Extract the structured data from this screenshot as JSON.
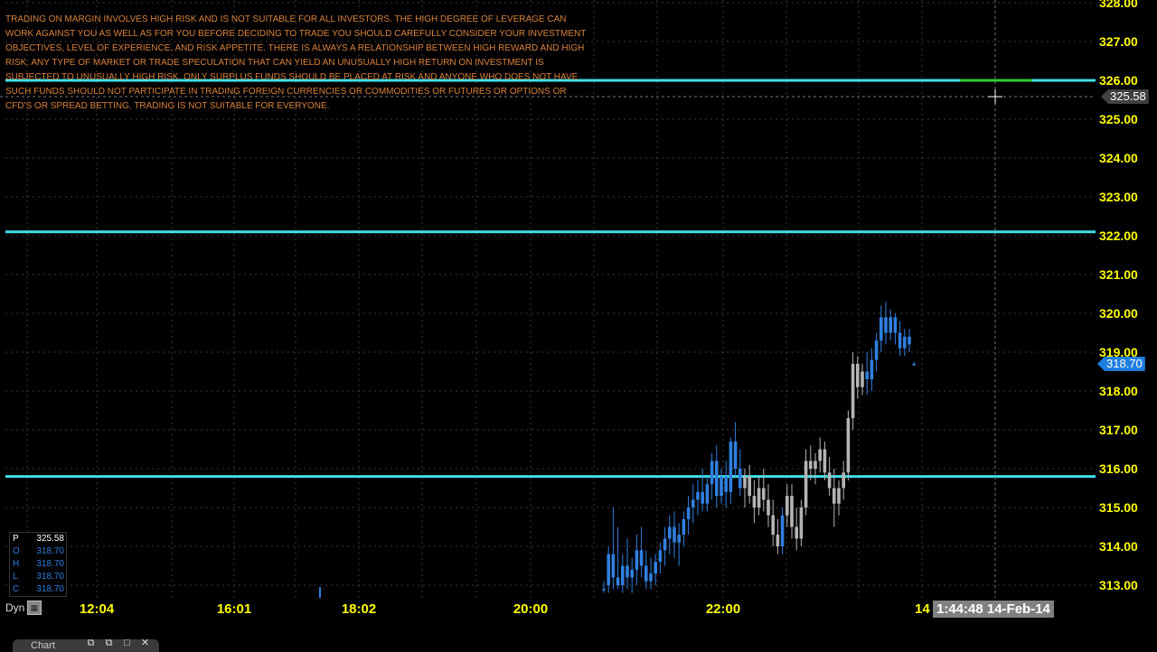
{
  "disclaimer": "TRADING ON MARGIN INVOLVES HIGH RISK AND IS NOT SUITABLE FOR ALL INVESTORS. THE HIGH DEGREE OF LEVERAGE CAN WORK AGAINST YOU AS WELL AS FOR YOU BEFORE DECIDING TO TRADE YOU SHOULD CAREFULLY CONSIDER YOUR INVESTMENT OBJECTIVES, LEVEL OF EXPERIENCE, AND RISK APPETITE. THERE IS ALWAYS A RELATIONSHIP BETWEEN HIGH REWARD AND HIGH RISK. ANY TYPE OF MARKET OR TRADE SPECULATION THAT CAN YIELD AN UNUSUALLY HIGH RETURN ON INVESTMENT IS SUBJECTED TO UNUSUALLY HIGH RISK. ONLY SURPLUS FUNDS SHOULD BE PLACED AT RISK AND ANYONE WHO DOES NOT HAVE SUCH FUNDS SHOULD NOT PARTICIPATE IN TRADING FOREIGN CURRENCIES OR COMMODITIES OR FUTURES OR OPTIONS OR CFD'S OR SPREAD BETTING. TRADING IS NOT SUITABLE FOR EVERYONE.",
  "colors": {
    "background": "#000000",
    "axis_text": "#ffff00",
    "disclaimer_text": "#d9823b",
    "level_line": "#40e0e8",
    "up_candle": "#2f7fe0",
    "down_candle": "#b4b4b4",
    "last_price_tag": "#1e7fe0",
    "cursor_tag": "#404040"
  },
  "price_axis": {
    "ticks": [
      "328.00",
      "327.00",
      "326.00",
      "325.00",
      "324.00",
      "323.00",
      "322.00",
      "321.00",
      "320.00",
      "319.00",
      "318.00",
      "317.00",
      "316.00",
      "315.00",
      "314.00",
      "313.00"
    ],
    "cursor_price": "325.58",
    "last_price": "318.70"
  },
  "time_axis": {
    "dyn_label": "Dyn",
    "ticks": [
      "12:04",
      "16:01",
      "18:02",
      "20:00",
      "22:00"
    ],
    "partial_label": "14",
    "crosshair_time": "1:44:48 14-Feb-14"
  },
  "ohlc_panel": {
    "rows": [
      {
        "key": "P",
        "value": "325.58"
      },
      {
        "key": "O",
        "value": "318.70"
      },
      {
        "key": "H",
        "value": "318.70"
      },
      {
        "key": "L",
        "value": "318.70"
      },
      {
        "key": "C",
        "value": "318.70"
      }
    ]
  },
  "bottom_bar": {
    "tab_label": "Chart"
  },
  "chart_data": {
    "type": "candlestick",
    "ylim": [
      312.6,
      328.0
    ],
    "xlabel": "",
    "ylabel": "",
    "horizontal_levels": [
      326.0,
      322.1,
      315.8
    ],
    "x_ticks": [
      "12:04",
      "16:01",
      "18:02",
      "20:00",
      "22:00"
    ],
    "cursor_price": 325.58,
    "last_price": 318.7,
    "candles": [
      {
        "o": 312.9,
        "h": 313.1,
        "l": 312.8,
        "c": 312.9,
        "d": "up"
      },
      {
        "o": 313.0,
        "h": 314.0,
        "l": 312.8,
        "c": 313.8,
        "d": "up"
      },
      {
        "o": 313.8,
        "h": 315.0,
        "l": 312.9,
        "c": 313.2,
        "d": "up"
      },
      {
        "o": 313.2,
        "h": 314.5,
        "l": 312.9,
        "c": 313.0,
        "d": "up"
      },
      {
        "o": 313.0,
        "h": 313.8,
        "l": 312.8,
        "c": 313.5,
        "d": "up"
      },
      {
        "o": 313.5,
        "h": 314.2,
        "l": 312.9,
        "c": 313.2,
        "d": "up"
      },
      {
        "o": 313.2,
        "h": 313.7,
        "l": 312.8,
        "c": 313.4,
        "d": "up"
      },
      {
        "o": 313.4,
        "h": 314.3,
        "l": 313.0,
        "c": 313.9,
        "d": "up"
      },
      {
        "o": 313.9,
        "h": 314.5,
        "l": 313.2,
        "c": 313.5,
        "d": "up"
      },
      {
        "o": 313.5,
        "h": 313.9,
        "l": 312.9,
        "c": 313.1,
        "d": "up"
      },
      {
        "o": 313.1,
        "h": 313.7,
        "l": 312.9,
        "c": 313.3,
        "d": "up"
      },
      {
        "o": 313.3,
        "h": 313.8,
        "l": 313.0,
        "c": 313.6,
        "d": "up"
      },
      {
        "o": 313.6,
        "h": 314.1,
        "l": 313.3,
        "c": 313.9,
        "d": "up"
      },
      {
        "o": 313.9,
        "h": 314.5,
        "l": 313.5,
        "c": 314.2,
        "d": "up"
      },
      {
        "o": 314.2,
        "h": 314.8,
        "l": 313.8,
        "c": 314.5,
        "d": "up"
      },
      {
        "o": 314.5,
        "h": 314.9,
        "l": 313.7,
        "c": 314.1,
        "d": "up"
      },
      {
        "o": 314.1,
        "h": 314.6,
        "l": 313.5,
        "c": 314.3,
        "d": "up"
      },
      {
        "o": 314.3,
        "h": 314.9,
        "l": 314.0,
        "c": 314.7,
        "d": "up"
      },
      {
        "o": 314.7,
        "h": 315.3,
        "l": 314.3,
        "c": 315.0,
        "d": "up"
      },
      {
        "o": 315.0,
        "h": 315.6,
        "l": 314.6,
        "c": 315.2,
        "d": "up"
      },
      {
        "o": 315.2,
        "h": 315.7,
        "l": 314.8,
        "c": 315.4,
        "d": "up"
      },
      {
        "o": 315.4,
        "h": 316.0,
        "l": 314.9,
        "c": 315.1,
        "d": "up"
      },
      {
        "o": 315.1,
        "h": 315.8,
        "l": 314.9,
        "c": 315.6,
        "d": "up"
      },
      {
        "o": 315.6,
        "h": 316.4,
        "l": 315.2,
        "c": 316.2,
        "d": "up"
      },
      {
        "o": 316.2,
        "h": 316.6,
        "l": 315.0,
        "c": 315.3,
        "d": "up"
      },
      {
        "o": 315.3,
        "h": 316.0,
        "l": 315.1,
        "c": 315.8,
        "d": "up"
      },
      {
        "o": 315.8,
        "h": 316.2,
        "l": 315.0,
        "c": 315.4,
        "d": "up"
      },
      {
        "o": 315.4,
        "h": 316.8,
        "l": 315.1,
        "c": 316.7,
        "d": "up"
      },
      {
        "o": 316.7,
        "h": 317.2,
        "l": 315.8,
        "c": 316.0,
        "d": "up"
      },
      {
        "o": 316.0,
        "h": 316.5,
        "l": 315.3,
        "c": 315.5,
        "d": "up"
      },
      {
        "o": 315.5,
        "h": 316.0,
        "l": 315.0,
        "c": 315.8,
        "d": "down"
      },
      {
        "o": 315.8,
        "h": 316.1,
        "l": 315.1,
        "c": 315.3,
        "d": "down"
      },
      {
        "o": 315.3,
        "h": 315.7,
        "l": 314.6,
        "c": 315.0,
        "d": "down"
      },
      {
        "o": 315.0,
        "h": 315.8,
        "l": 314.8,
        "c": 315.5,
        "d": "down"
      },
      {
        "o": 315.5,
        "h": 316.0,
        "l": 314.9,
        "c": 315.2,
        "d": "down"
      },
      {
        "o": 315.2,
        "h": 315.6,
        "l": 314.5,
        "c": 314.8,
        "d": "down"
      },
      {
        "o": 314.8,
        "h": 315.2,
        "l": 314.0,
        "c": 314.3,
        "d": "down"
      },
      {
        "o": 314.3,
        "h": 314.7,
        "l": 313.8,
        "c": 314.0,
        "d": "down"
      },
      {
        "o": 314.0,
        "h": 315.0,
        "l": 313.8,
        "c": 314.8,
        "d": "up"
      },
      {
        "o": 314.8,
        "h": 315.6,
        "l": 314.5,
        "c": 315.3,
        "d": "down"
      },
      {
        "o": 315.3,
        "h": 315.6,
        "l": 314.2,
        "c": 314.5,
        "d": "down"
      },
      {
        "o": 314.5,
        "h": 315.0,
        "l": 313.9,
        "c": 314.2,
        "d": "down"
      },
      {
        "o": 314.2,
        "h": 315.2,
        "l": 314.0,
        "c": 315.0,
        "d": "down"
      },
      {
        "o": 315.0,
        "h": 316.5,
        "l": 314.8,
        "c": 316.2,
        "d": "down"
      },
      {
        "o": 316.2,
        "h": 316.6,
        "l": 315.7,
        "c": 316.0,
        "d": "down"
      },
      {
        "o": 316.0,
        "h": 316.4,
        "l": 315.6,
        "c": 316.2,
        "d": "down"
      },
      {
        "o": 316.2,
        "h": 316.8,
        "l": 315.9,
        "c": 316.5,
        "d": "down"
      },
      {
        "o": 316.5,
        "h": 316.7,
        "l": 315.7,
        "c": 315.9,
        "d": "down"
      },
      {
        "o": 315.9,
        "h": 316.3,
        "l": 315.3,
        "c": 315.5,
        "d": "down"
      },
      {
        "o": 315.5,
        "h": 316.0,
        "l": 314.5,
        "c": 315.1,
        "d": "down"
      },
      {
        "o": 315.1,
        "h": 315.7,
        "l": 314.8,
        "c": 315.5,
        "d": "down"
      },
      {
        "o": 315.5,
        "h": 316.2,
        "l": 315.2,
        "c": 315.9,
        "d": "down"
      },
      {
        "o": 315.9,
        "h": 317.5,
        "l": 315.7,
        "c": 317.3,
        "d": "down"
      },
      {
        "o": 317.3,
        "h": 319.0,
        "l": 317.0,
        "c": 318.7,
        "d": "down"
      },
      {
        "o": 318.7,
        "h": 318.9,
        "l": 317.8,
        "c": 318.1,
        "d": "down"
      },
      {
        "o": 318.1,
        "h": 318.7,
        "l": 317.9,
        "c": 318.5,
        "d": "down"
      },
      {
        "o": 318.5,
        "h": 319.0,
        "l": 317.9,
        "c": 318.3,
        "d": "up"
      },
      {
        "o": 318.3,
        "h": 319.1,
        "l": 318.0,
        "c": 318.8,
        "d": "up"
      },
      {
        "o": 318.8,
        "h": 319.5,
        "l": 318.5,
        "c": 319.3,
        "d": "up"
      },
      {
        "o": 319.3,
        "h": 320.2,
        "l": 319.0,
        "c": 319.9,
        "d": "up"
      },
      {
        "o": 319.9,
        "h": 320.3,
        "l": 319.2,
        "c": 319.5,
        "d": "up"
      },
      {
        "o": 319.5,
        "h": 320.1,
        "l": 319.3,
        "c": 319.9,
        "d": "up"
      },
      {
        "o": 319.9,
        "h": 320.0,
        "l": 319.2,
        "c": 319.5,
        "d": "up"
      },
      {
        "o": 319.5,
        "h": 319.8,
        "l": 318.9,
        "c": 319.1,
        "d": "up"
      },
      {
        "o": 319.1,
        "h": 319.6,
        "l": 318.9,
        "c": 319.4,
        "d": "up"
      },
      {
        "o": 319.4,
        "h": 319.6,
        "l": 319.0,
        "c": 319.2,
        "d": "up"
      },
      {
        "o": 318.7,
        "h": 318.75,
        "l": 318.65,
        "c": 318.7,
        "d": "up"
      }
    ]
  }
}
